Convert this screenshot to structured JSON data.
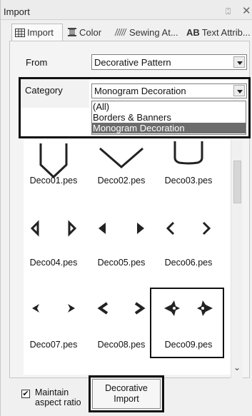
{
  "window": {
    "title": "Import",
    "pin_glyph": "⍠",
    "close_glyph": "✕"
  },
  "tabs": [
    {
      "label": "Import",
      "icon": "import-grid-icon"
    },
    {
      "label": "Color",
      "icon": "color-spool-icon"
    },
    {
      "label": "Sewing At...",
      "icon": "sewing-pattern-icon"
    },
    {
      "label": "Text Attrib...",
      "icon": "ab-text-icon",
      "icon_text": "AB"
    }
  ],
  "from": {
    "label": "From",
    "value": "Decorative Pattern"
  },
  "category": {
    "label": "Category",
    "value": "Monogram Decoration",
    "options": [
      "(All)",
      "Borders & Banners",
      "Monogram Decoration"
    ],
    "selected_index": 2
  },
  "items": [
    {
      "name": "Deco01.pes",
      "shape": "hexagon-frame"
    },
    {
      "name": "Deco02.pes",
      "shape": "diamond-frame"
    },
    {
      "name": "Deco03.pes",
      "shape": "shield-frame"
    },
    {
      "name": "Deco04.pes",
      "shape": "triangle-pair"
    },
    {
      "name": "Deco05.pes",
      "shape": "solid-triangle-pair"
    },
    {
      "name": "Deco06.pes",
      "shape": "chevron-pair"
    },
    {
      "name": "Deco07.pes",
      "shape": "notched-arrow-pair"
    },
    {
      "name": "Deco08.pes",
      "shape": "bold-chevron-pair"
    },
    {
      "name": "Deco09.pes",
      "shape": "ornamental-pair"
    }
  ],
  "bottom": {
    "checkbox_label_line1": "Maintain",
    "checkbox_label_line2": "aspect ratio",
    "checkbox_checked": true,
    "check_glyph": "✔",
    "button_line1": "Decorative",
    "button_line2": "Import"
  }
}
